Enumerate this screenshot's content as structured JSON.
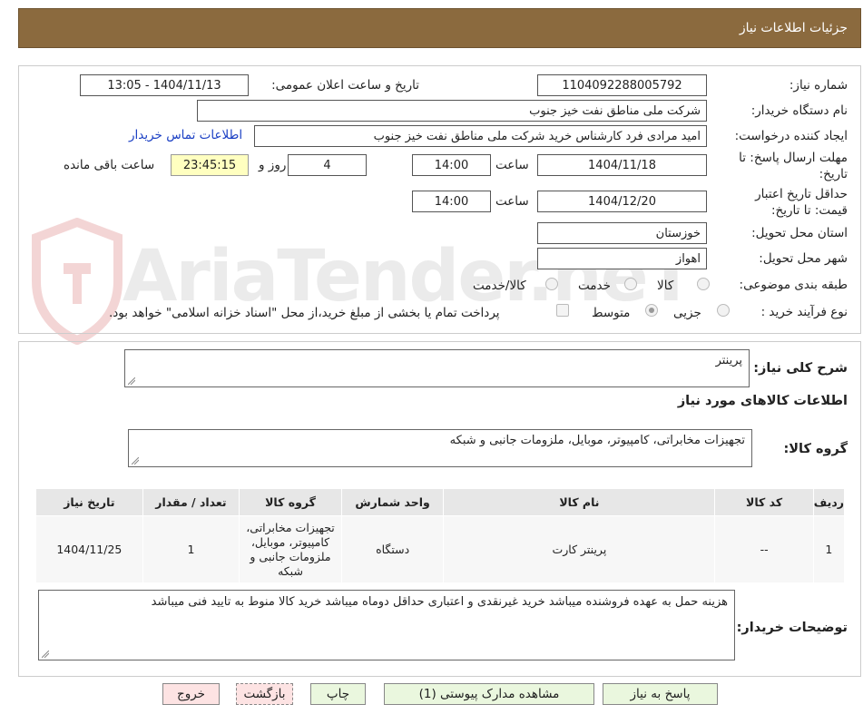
{
  "header": {
    "title": "جزئیات اطلاعات نیاز"
  },
  "watermark": {
    "text": "AriaTender.neT"
  },
  "form": {
    "need_number_label": "شماره نیاز:",
    "need_number": "1104092288005792",
    "announce_label": "تاریخ و ساعت اعلان عمومی:",
    "announce_value": "1404/11/13 - 13:05",
    "buyer_label": "نام دستگاه خریدار:",
    "buyer_value": "شرکت ملی مناطق نفت خیز جنوب",
    "creator_label": "ایجاد کننده درخواست:",
    "creator_value": "امید مرادی فرد کارشناس خرید شرکت ملی مناطق نفت خیز جنوب",
    "contact_link": "اطلاعات تماس خریدار",
    "deadline_label": "مهلت ارسال پاسخ: تا تاریخ:",
    "deadline_date": "1404/11/18",
    "time_label": "ساعت",
    "deadline_time": "14:00",
    "days_value": "4",
    "days_label": "روز و",
    "remaining_value": "23:45:15",
    "remaining_label": "ساعت باقی مانده",
    "validity_label": "حداقل تاریخ اعتبار قیمت: تا تاریخ:",
    "validity_date": "1404/12/20",
    "validity_time": "14:00",
    "province_label": "استان محل تحویل:",
    "province_value": "خوزستان",
    "city_label": "شهر محل تحویل:",
    "city_value": "اهواز",
    "category_label": "طبقه بندی موضوعی:",
    "category_options": [
      "کالا",
      "خدمت",
      "کالا/خدمت"
    ],
    "process_label": "نوع فرآیند خرید :",
    "process_options": [
      "جزیی",
      "متوسط"
    ],
    "payment_note": "پرداخت تمام یا بخشی از مبلغ خرید،از محل \"اسناد خزانه اسلامی\" خواهد بود."
  },
  "summary": {
    "label": "شرح کلی نیاز:",
    "value": "پرینتر",
    "goods_info_title": "اطلاعات کالاهای مورد نیاز",
    "group_label": "گروه کالا:",
    "group_value": "تجهیزات مخابراتی، کامپیوتر، موبایل، ملزومات جانبی و شبکه"
  },
  "table": {
    "headers": [
      "ردیف",
      "کد کالا",
      "نام کالا",
      "واحد شمارش",
      "گروه کالا",
      "تعداد / مقدار",
      "تاریخ نیاز"
    ],
    "rows": [
      [
        "1",
        "--",
        "پرینتر کارت",
        "دستگاه",
        "تجهیزات مخابراتی، کامپیوتر، موبایل، ملزومات جانبی و شبکه",
        "1",
        "1404/11/25"
      ]
    ]
  },
  "notes": {
    "label": "توضیحات خریدار:",
    "value": "هزینه حمل به عهده فروشنده میباشد خرید غیرنقدی و اعتباری حداقل دوماه میباشد خرید کالا منوط به تایید فنی میباشد"
  },
  "buttons": {
    "reply": "پاسخ به نیاز",
    "attachments": "مشاهده مدارک پیوستی (1)",
    "print": "چاپ",
    "back": "بازگشت",
    "exit": "خروج"
  },
  "colors": {
    "header_bg": "#8b6a3e",
    "link": "#1a3fc4",
    "timer_bg": "#ffffc0"
  }
}
